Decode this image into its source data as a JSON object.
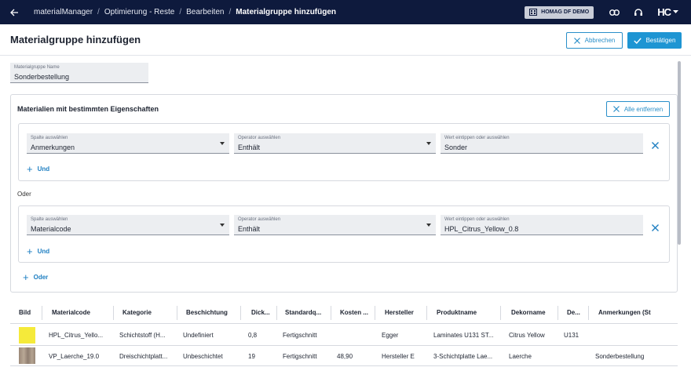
{
  "topbar": {
    "breadcrumbs": [
      "materialManager",
      "Optimierung - Reste",
      "Bearbeiten",
      "Materialgruppe hinzufügen"
    ],
    "tenant": "HOMAG DF DEMO",
    "logo": "HC"
  },
  "header": {
    "title": "Materialgruppe hinzufügen",
    "cancel_label": "Abbrechen",
    "confirm_label": "Bestätigen"
  },
  "name_field": {
    "label": "Materialgruppe Name",
    "value": "Sonderbestellung"
  },
  "criteria": {
    "title": "Materialien mit bestimmten Eigenschaften",
    "remove_all_label": "Alle entfernen",
    "or_separator": "Oder",
    "add_or_label": "Oder",
    "groups": [
      {
        "column_label": "Spalte auswählen",
        "column_value": "Anmerkungen",
        "operator_label": "Operator auswählen",
        "operator_value": "Enthält",
        "value_label": "Wert eintippen oder auswählen",
        "value_value": "Sonder",
        "add_and_label": "Und"
      },
      {
        "column_label": "Spalte auswählen",
        "column_value": "Materialcode",
        "operator_label": "Operator auswählen",
        "operator_value": "Enthält",
        "value_label": "Wert eintippen oder auswählen",
        "value_value": "HPL_Citrus_Yellow_0.8",
        "add_and_label": "Und"
      }
    ]
  },
  "table": {
    "columns": [
      "Bild",
      "Materialcode",
      "Kategorie",
      "Beschichtung",
      "Dick...",
      "Standardq...",
      "Kosten ...",
      "Hersteller",
      "Produktname",
      "Dekorname",
      "De...",
      "Anmerkungen (St"
    ],
    "rows": [
      {
        "swatch": "#f5ea3a",
        "cells": [
          "HPL_Citrus_Yello...",
          "Schichtstoff (H...",
          "Undefiniert",
          "0,8",
          "Fertigschnitt",
          "",
          "Egger",
          "Laminates U131 ST...",
          "Citrus Yellow",
          "U131",
          ""
        ]
      },
      {
        "swatch": "#a8978a",
        "cells": [
          "VP_Laerche_19.0",
          "Dreischichtplatt...",
          "Unbeschichtet",
          "19",
          "Fertigschnitt",
          "48,90",
          "Hersteller E",
          "3-Schichtplatte Lae...",
          "Laerche",
          "",
          "Sonderbestellung"
        ]
      }
    ]
  },
  "colors": {
    "topbar": "#0e1a3d",
    "accent": "#1e95d3"
  }
}
